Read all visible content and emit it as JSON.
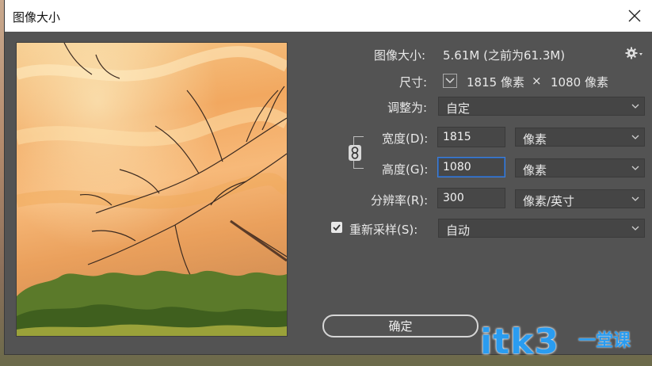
{
  "window": {
    "title": "图像大小"
  },
  "image_size": {
    "label": "图像大小:",
    "value": "5.61M (之前为61.3M)"
  },
  "dimensions": {
    "label": "尺寸:",
    "width": "1815 像素",
    "times": "×",
    "height": "1080 像素"
  },
  "fit_to": {
    "label": "调整为:",
    "value": "自定"
  },
  "width": {
    "label": "宽度(D):",
    "value": "1815",
    "unit": "像素"
  },
  "height": {
    "label": "高度(G):",
    "value": "1080",
    "unit": "像素"
  },
  "resolution": {
    "label": "分辨率(R):",
    "value": "300",
    "unit": "像素/英寸"
  },
  "resample": {
    "label": "重新采样(S):",
    "checked": true,
    "value": "自动"
  },
  "ok_button": {
    "label": "确定"
  },
  "watermark": {
    "main": "itk3",
    "sub": "一堂课"
  },
  "colors": {
    "dialog_bg": "#535353",
    "field_bg": "#454545",
    "focus": "#3f7fd9",
    "watermark": "#2a9cf0"
  },
  "icons": [
    "close-icon",
    "gear-icon",
    "chevron-down-icon",
    "link-icon",
    "checkmark-icon"
  ]
}
